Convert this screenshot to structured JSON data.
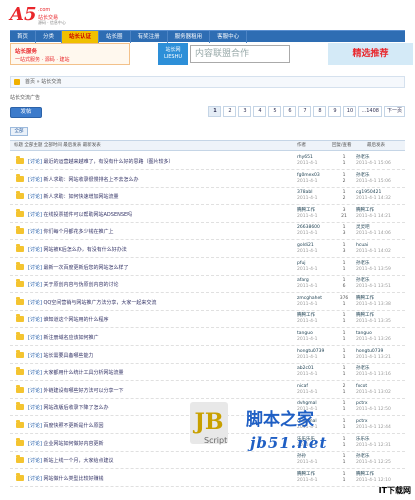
{
  "logo": {
    "mark": "A5",
    "domain": ".com",
    "slogan": "站长交易",
    "slogan2": "源码 · 信息中心"
  },
  "nav": [
    "首页",
    "分类",
    "站长认证",
    "站长圈",
    "有奖注册",
    "服务器租用",
    "客服中心"
  ],
  "ads": {
    "ad1_line1": "站长服务",
    "ad1_line2": "一站式服务 · 源码 · 建站",
    "ad2": "站长网 LIESHU",
    "ad3": "内容联盟合作",
    "ad4": "精选推荐"
  },
  "breadcrumb": "首页 » 站长交流",
  "subtitle": "站长交流广告",
  "new_button": "发帖",
  "pager": [
    "1",
    "2",
    "3",
    "4",
    "5",
    "6",
    "7",
    "8",
    "9",
    "10",
    "...1408",
    "下一页"
  ],
  "all_button": "全部",
  "table_header": {
    "title": "标题 全部主题 全部时间 最后发表 最新发表",
    "author": "作者",
    "count": "回复/查看",
    "last": "最后发表"
  },
  "rows": [
    {
      "cat": "[讨论]",
      "title": "最近的运营越来越难了，有没有什么好的思路（图片较多）",
      "author": "rhy651",
      "date": "2011-4-1",
      "count": "1\n1",
      "last": "孙老乐",
      "ldate": "2011-4-1 15:06"
    },
    {
      "cat": "[讨论]",
      "title": "新人求助：网站收录很慢排名上不去怎么办",
      "author": "fg0mex03",
      "date": "2011-4-1",
      "count": "1\n2",
      "last": "孙老乐",
      "ldate": "2011-4-1 15:06"
    },
    {
      "cat": "[讨论]",
      "title": "新人求助：如何快速增加网站流量",
      "author": "378abl",
      "date": "2011-4-1",
      "count": "1\n2",
      "last": "cg1950421",
      "ldate": "2011-4-1 14:32"
    },
    {
      "cat": "[讨论]",
      "title": "在线投票插件可以帮助网站ADSENSE吗",
      "author": "腾腾工作",
      "date": "2011-4-1",
      "count": "3\n21",
      "last": "腾腾工作",
      "ldate": "2011-4-1 14:21"
    },
    {
      "cat": "[讨论]",
      "title": "你们每个月都花多少钱在推广上",
      "author": "26638600",
      "date": "2011-4-1",
      "count": "1\n3",
      "last": "灵灵吧",
      "ldate": "2011-4-1 14:06"
    },
    {
      "cat": "[讨论]",
      "title": "网站被K后怎么办，有没有什么好办法",
      "author": "goldi21",
      "date": "2011-4-1",
      "count": "1\n3",
      "last": "hcuai",
      "ldate": "2011-4-1 14:02"
    },
    {
      "cat": "[讨论]",
      "title": "最新一次百度更新后您的网站怎么样了",
      "author": "pfuj",
      "date": "2011-4-1",
      "count": "1\n1",
      "last": "孙老乐",
      "ldate": "2011-4-1 13:59"
    },
    {
      "cat": "[讨论]",
      "title": "关于原创内容与伪原创内容的讨论",
      "author": "afarg",
      "date": "2011-4-1",
      "count": "1\n6",
      "last": "孙老乐",
      "ldate": "2011-4-1 13:51"
    },
    {
      "cat": "[讨论]",
      "title": "QQ空间营销与网站推广方法分享，大家一起来交流",
      "author": "zmcghahet",
      "date": "2011-4-1",
      "count": "376\n1",
      "last": "腾腾工作",
      "ldate": "2011-4-1 13:38"
    },
    {
      "cat": "[讨论]",
      "title": "谁知道这个网站用的什么程序",
      "author": "腾腾工作",
      "date": "2011-4-1",
      "count": "1\n1",
      "last": "腾腾工作",
      "ldate": "2011-4-1 13:35"
    },
    {
      "cat": "[讨论]",
      "title": "新注册域名应该如何推广",
      "author": "tanguo",
      "date": "2011-4-1",
      "count": "1\n1",
      "last": "tanguo",
      "ldate": "2011-4-1 13:26"
    },
    {
      "cat": "[讨论]",
      "title": "站长需要具备哪些能力",
      "author": "hongtu0739",
      "date": "2011-4-1",
      "count": "1\n1",
      "last": "hongtu0739",
      "ldate": "2011-4-1 13:21"
    },
    {
      "cat": "[讨论]",
      "title": "大家都用什么统计工具分析网站流量",
      "author": "ab2c01",
      "date": "2011-4-1",
      "count": "1\n1",
      "last": "孙老乐",
      "ldate": "2011-4-1 13:16"
    },
    {
      "cat": "[讨论]",
      "title": "外链建设有哪些好方法可以分享一下",
      "author": "nicaf",
      "date": "2011-4-1",
      "count": "2\n1",
      "last": "fxcot",
      "ldate": "2011-4-1 13:02"
    },
    {
      "cat": "[讨论]",
      "title": "网站改版后收录下降了怎么办",
      "author": "dvhgmal",
      "date": "2011-4-1",
      "count": "1\n1",
      "last": "pctrx",
      "ldate": "2011-4-1 12:50"
    },
    {
      "cat": "[讨论]",
      "title": "百度快照不更新是什么原因",
      "author": "dvhgmal",
      "date": "2011-4-1",
      "count": "1\n1",
      "last": "pctrx",
      "ldate": "2011-4-1 12:44"
    },
    {
      "cat": "[讨论]",
      "title": "企业网站如何做好内容更新",
      "author": "乐乐乐乐",
      "date": "2011-4-1",
      "count": "1\n1",
      "last": "乐乐乐",
      "ldate": "2011-4-1 12:31"
    },
    {
      "cat": "[讨论]",
      "title": "新站上线一个月，大家给点建议",
      "author": "孙孙",
      "date": "2011-4-1",
      "count": "1\n1",
      "last": "孙老乐",
      "ldate": "2011-4-1 12:25"
    },
    {
      "cat": "[讨论]",
      "title": "网站做什么类型比较好赚钱",
      "author": "腾腾工作",
      "date": "2011-4-1",
      "count": "1\n1",
      "last": "腾腾工作",
      "ldate": "2011-4-1 12:10"
    }
  ],
  "watermark": {
    "jb": "JB",
    "script": "Script",
    "cn": "脚本之家",
    "url": "jb51.net"
  },
  "badge": "IT下载网"
}
